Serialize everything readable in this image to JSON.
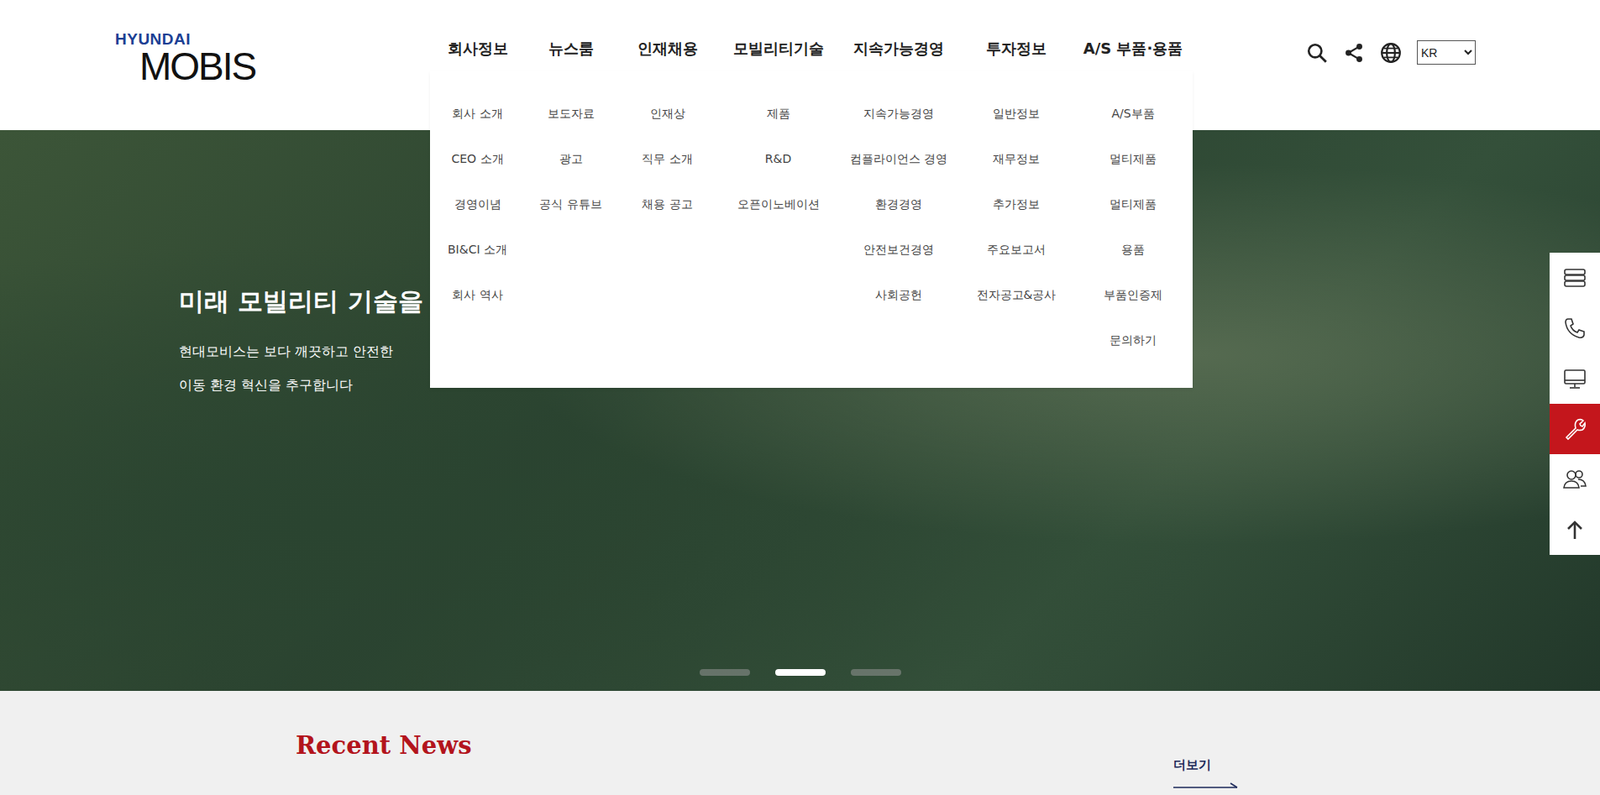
{
  "logo": {
    "brand": "HYUNDAI",
    "name": "MOBIS"
  },
  "nav": [
    {
      "label": "회사정보",
      "items": [
        "회사 소개",
        "CEO 소개",
        "경영이념",
        "BI&CI 소개",
        "회사 역사"
      ]
    },
    {
      "label": "뉴스룸",
      "items": [
        "보도자료",
        "광고",
        "공식 유튜브"
      ]
    },
    {
      "label": "인재채용",
      "items": [
        "인재상",
        "직무 소개",
        "채용 공고"
      ]
    },
    {
      "label": "모빌리티기술",
      "items": [
        "제품",
        "R&D",
        "오픈이노베이션"
      ]
    },
    {
      "label": "지속가능경영",
      "items": [
        "지속가능경영",
        "컴플라이언스 경영",
        "환경경영",
        "안전보건경영",
        "사회공헌"
      ]
    },
    {
      "label": "투자정보",
      "items": [
        "일반정보",
        "재무정보",
        "추가정보",
        "주요보고서",
        "전자공고&공사"
      ]
    },
    {
      "label": "A/S 부품·용품",
      "items": [
        "A/S부품",
        "멀티제품",
        "멀티제품",
        "용품",
        "부품인증제",
        "문의하기"
      ]
    }
  ],
  "header_tools": {
    "language": "KR"
  },
  "hero": {
    "title": "미래 모빌리티 기술을",
    "lines": [
      "현대모비스는 보다 깨끗하고 안전한",
      "이동 환경 혁신을 추구합니다"
    ],
    "slides": [
      {
        "selected": false
      },
      {
        "selected": true
      },
      {
        "selected": false
      }
    ]
  },
  "quick_menu": [
    {
      "kind": "servers",
      "selected": false
    },
    {
      "kind": "phone",
      "selected": false
    },
    {
      "kind": "monitor",
      "selected": false
    },
    {
      "kind": "wrench",
      "selected": true
    },
    {
      "kind": "users",
      "selected": false
    },
    {
      "kind": "top",
      "selected": false
    }
  ],
  "recent_news": {
    "title": "Recent News",
    "more": "더보기"
  }
}
